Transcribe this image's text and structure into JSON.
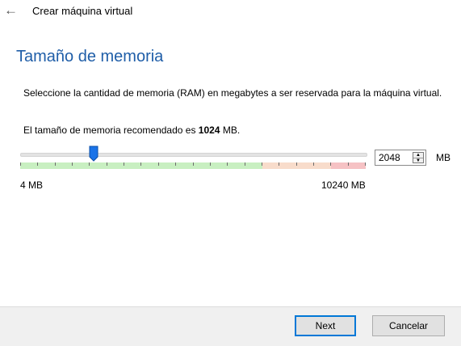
{
  "header": {
    "back_icon": "back-arrow-icon",
    "wizard_title": "Crear máquina virtual"
  },
  "page": {
    "title": "Tamaño de memoria",
    "description": "Seleccione la cantidad de memoria (RAM) en megabytes a ser reservada para la máquina virtual.",
    "recommend_prefix": "El tamaño de memoria recomendado es ",
    "recommend_value": "1024",
    "recommend_suffix": " MB."
  },
  "memory": {
    "slider_min_label": "4 MB",
    "slider_max_label": "10240 MB",
    "slider_min": 4,
    "slider_max": 10240,
    "value": "2048",
    "unit": "MB",
    "zone_colors": {
      "green": "#c8efc1",
      "orange": "#f8dccb",
      "red": "#f6c2c4"
    },
    "handle_color": "#1a73e8"
  },
  "footer": {
    "next_label": "Next",
    "cancel_label": "Cancelar"
  }
}
